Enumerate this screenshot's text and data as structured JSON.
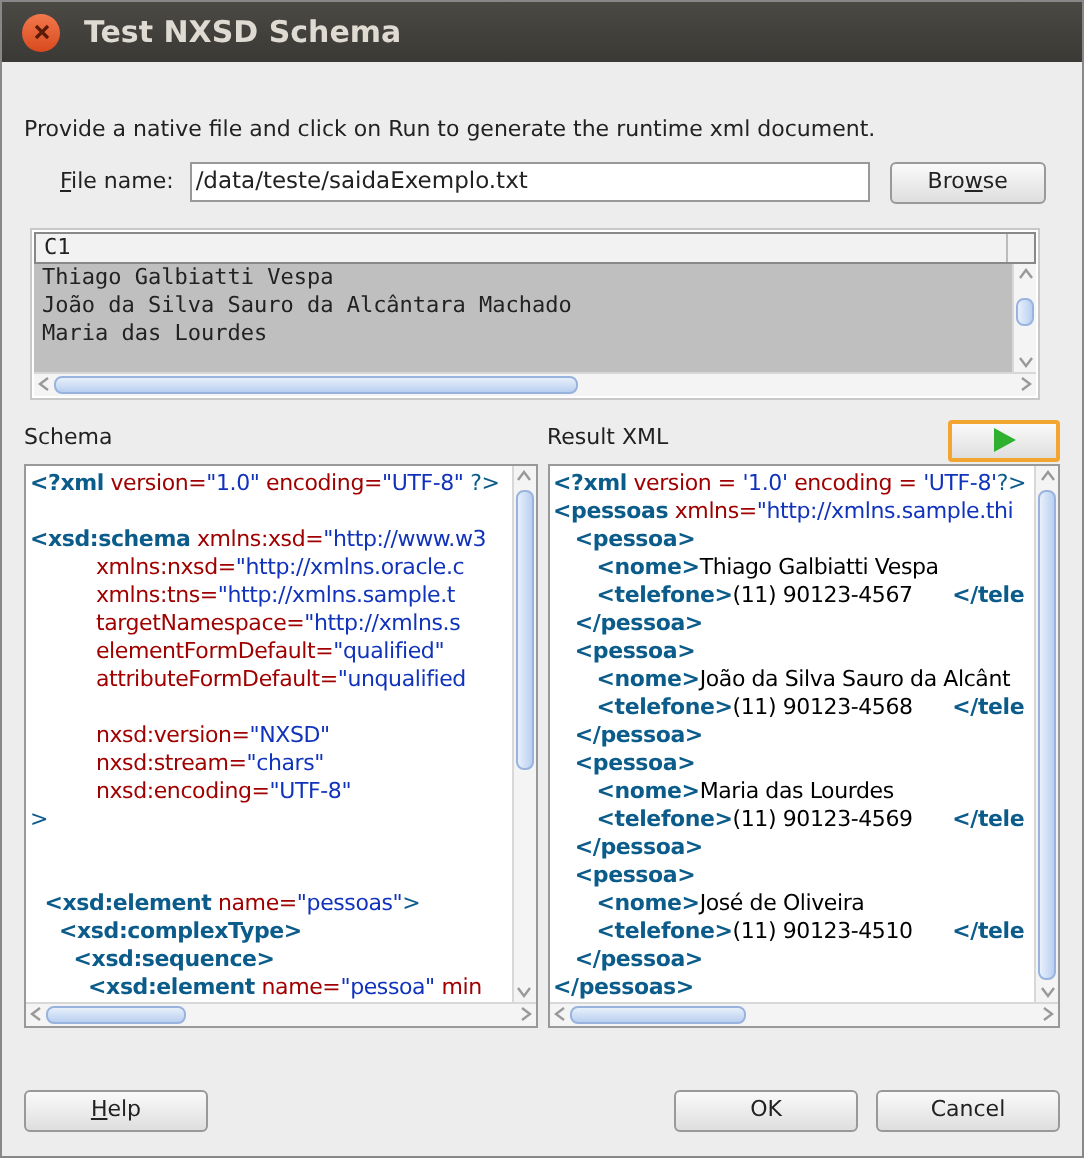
{
  "window": {
    "title": "Test NXSD Schema"
  },
  "instruction": "Provide a native file and click on Run to generate the runtime xml document.",
  "file_field": {
    "label_parts": [
      {
        "text": "F",
        "underline": true
      },
      {
        "text": "ile name:",
        "underline": false
      }
    ],
    "value": "/data/teste/saidaExemplo.txt"
  },
  "browse_button": {
    "label_parts": [
      {
        "text": "Bro",
        "underline": false
      },
      {
        "text": "w",
        "underline": true
      },
      {
        "text": "se",
        "underline": false
      }
    ]
  },
  "preview_table": {
    "columns": [
      "C1"
    ],
    "rows": [
      {
        "cells": [
          "Thiago Galbiatti Vespa"
        ],
        "selected": true
      },
      {
        "cells": [
          "João da Silva Sauro da Alcântara Machado"
        ],
        "selected": true
      },
      {
        "cells": [
          "Maria das Lourdes"
        ],
        "selected": true
      }
    ]
  },
  "schema_panel": {
    "title": "Schema",
    "lines": [
      {
        "kind": "code",
        "tokens": [
          {
            "kind": "tag",
            "text": "<?xml"
          },
          {
            "kind": "attr",
            "text": " version="
          },
          {
            "kind": "value",
            "text": "\"1.0\""
          },
          {
            "kind": "attr",
            "text": " encoding="
          },
          {
            "kind": "value",
            "text": "\"UTF-8\""
          },
          {
            "kind": "punct",
            "text": " ?>"
          }
        ]
      },
      {
        "kind": "blank"
      },
      {
        "kind": "code",
        "tokens": [
          {
            "kind": "tag",
            "text": "<xsd:schema"
          },
          {
            "kind": "attr",
            "text": " xmlns:xsd="
          },
          {
            "kind": "value",
            "text": "\"http://www.w3"
          }
        ]
      },
      {
        "kind": "code",
        "tokens": [
          {
            "kind": "attr",
            "text": "          xmlns:nxsd="
          },
          {
            "kind": "value",
            "text": "\"http://xmlns.oracle.c"
          }
        ]
      },
      {
        "kind": "code",
        "tokens": [
          {
            "kind": "attr",
            "text": "          xmlns:tns="
          },
          {
            "kind": "value",
            "text": "\"http://xmlns.sample.t"
          }
        ]
      },
      {
        "kind": "code",
        "tokens": [
          {
            "kind": "attr",
            "text": "          targetNamespace="
          },
          {
            "kind": "value",
            "text": "\"http://xmlns.s"
          }
        ]
      },
      {
        "kind": "code",
        "tokens": [
          {
            "kind": "attr",
            "text": "          elementFormDefault="
          },
          {
            "kind": "value",
            "text": "\"qualified\""
          }
        ]
      },
      {
        "kind": "code",
        "tokens": [
          {
            "kind": "attr",
            "text": "          attributeFormDefault="
          },
          {
            "kind": "value",
            "text": "\"unqualified"
          }
        ]
      },
      {
        "kind": "blank"
      },
      {
        "kind": "code",
        "tokens": [
          {
            "kind": "attr",
            "text": "          nxsd:version="
          },
          {
            "kind": "value",
            "text": "\"NXSD\""
          }
        ]
      },
      {
        "kind": "code",
        "tokens": [
          {
            "kind": "attr",
            "text": "          nxsd:stream="
          },
          {
            "kind": "value",
            "text": "\"chars\""
          }
        ]
      },
      {
        "kind": "code",
        "tokens": [
          {
            "kind": "attr",
            "text": "          nxsd:encoding="
          },
          {
            "kind": "value",
            "text": "\"UTF-8\""
          }
        ]
      },
      {
        "kind": "code",
        "tokens": [
          {
            "kind": "punct",
            "text": ">"
          }
        ]
      },
      {
        "kind": "blank"
      },
      {
        "kind": "blank"
      },
      {
        "kind": "code",
        "tokens": [
          {
            "kind": "tag",
            "text": "  <xsd:element"
          },
          {
            "kind": "attr",
            "text": " name="
          },
          {
            "kind": "value",
            "text": "\"pessoas\""
          },
          {
            "kind": "punct",
            "text": ">"
          }
        ]
      },
      {
        "kind": "code",
        "tokens": [
          {
            "kind": "tag",
            "text": "    <xsd:complexType>"
          }
        ]
      },
      {
        "kind": "code",
        "tokens": [
          {
            "kind": "tag",
            "text": "      <xsd:sequence>"
          }
        ]
      },
      {
        "kind": "code",
        "tokens": [
          {
            "kind": "tag",
            "text": "        <xsd:element"
          },
          {
            "kind": "attr",
            "text": " name="
          },
          {
            "kind": "value",
            "text": "\"pessoa\""
          },
          {
            "kind": "attr",
            "text": " min"
          }
        ]
      }
    ]
  },
  "result_panel": {
    "title": "Result XML",
    "lines": [
      {
        "kind": "code",
        "tokens": [
          {
            "kind": "tag",
            "text": "<?xml"
          },
          {
            "kind": "attr",
            "text": " version = "
          },
          {
            "kind": "value",
            "text": "'1.0'"
          },
          {
            "kind": "attr",
            "text": " encoding = "
          },
          {
            "kind": "value",
            "text": "'UTF-8'"
          },
          {
            "kind": "punct",
            "text": "?>"
          }
        ]
      },
      {
        "kind": "code",
        "tokens": [
          {
            "kind": "tag",
            "text": "<pessoas"
          },
          {
            "kind": "attr",
            "text": " xmlns="
          },
          {
            "kind": "value",
            "text": "\"http://xmlns.sample.thi"
          }
        ]
      },
      {
        "kind": "code",
        "tokens": [
          {
            "kind": "tag",
            "text": "   <pessoa>"
          }
        ]
      },
      {
        "kind": "code",
        "tokens": [
          {
            "kind": "tag",
            "text": "      <nome>"
          },
          {
            "kind": "text",
            "text": "Thiago Galbiatti Vespa"
          }
        ]
      },
      {
        "kind": "code",
        "tokens": [
          {
            "kind": "tag",
            "text": "      <telefone>"
          },
          {
            "kind": "text",
            "text": "(11) 90123-4567      "
          },
          {
            "kind": "tag",
            "text": "</tele"
          }
        ]
      },
      {
        "kind": "code",
        "tokens": [
          {
            "kind": "tag",
            "text": "   </pessoa>"
          }
        ]
      },
      {
        "kind": "code",
        "tokens": [
          {
            "kind": "tag",
            "text": "   <pessoa>"
          }
        ]
      },
      {
        "kind": "code",
        "tokens": [
          {
            "kind": "tag",
            "text": "      <nome>"
          },
          {
            "kind": "text",
            "text": "João da Silva Sauro da Alcânt"
          }
        ]
      },
      {
        "kind": "code",
        "tokens": [
          {
            "kind": "tag",
            "text": "      <telefone>"
          },
          {
            "kind": "text",
            "text": "(11) 90123-4568      "
          },
          {
            "kind": "tag",
            "text": "</tele"
          }
        ]
      },
      {
        "kind": "code",
        "tokens": [
          {
            "kind": "tag",
            "text": "   </pessoa>"
          }
        ]
      },
      {
        "kind": "code",
        "tokens": [
          {
            "kind": "tag",
            "text": "   <pessoa>"
          }
        ]
      },
      {
        "kind": "code",
        "tokens": [
          {
            "kind": "tag",
            "text": "      <nome>"
          },
          {
            "kind": "text",
            "text": "Maria das Lourdes"
          }
        ]
      },
      {
        "kind": "code",
        "tokens": [
          {
            "kind": "tag",
            "text": "      <telefone>"
          },
          {
            "kind": "text",
            "text": "(11) 90123-4569      "
          },
          {
            "kind": "tag",
            "text": "</tele"
          }
        ]
      },
      {
        "kind": "code",
        "tokens": [
          {
            "kind": "tag",
            "text": "   </pessoa>"
          }
        ]
      },
      {
        "kind": "code",
        "tokens": [
          {
            "kind": "tag",
            "text": "   <pessoa>"
          }
        ]
      },
      {
        "kind": "code",
        "tokens": [
          {
            "kind": "tag",
            "text": "      <nome>"
          },
          {
            "kind": "text",
            "text": "José de Oliveira"
          }
        ]
      },
      {
        "kind": "code",
        "tokens": [
          {
            "kind": "tag",
            "text": "      <telefone>"
          },
          {
            "kind": "text",
            "text": "(11) 90123-4510      "
          },
          {
            "kind": "tag",
            "text": "</tele"
          }
        ]
      },
      {
        "kind": "code",
        "tokens": [
          {
            "kind": "tag",
            "text": "   </pessoa>"
          }
        ]
      },
      {
        "kind": "code",
        "tokens": [
          {
            "kind": "tag",
            "text": "</pessoas>"
          }
        ]
      }
    ]
  },
  "buttons": [
    {
      "label_parts": [
        {
          "text": "H",
          "underline": true
        },
        {
          "text": "elp",
          "underline": false
        }
      ],
      "kind": "left"
    },
    {
      "label_parts": [
        {
          "text": "OK",
          "underline": false
        }
      ],
      "kind": "right"
    },
    {
      "label_parts": [
        {
          "text": "Cancel",
          "underline": false
        }
      ],
      "kind": "right"
    }
  ]
}
